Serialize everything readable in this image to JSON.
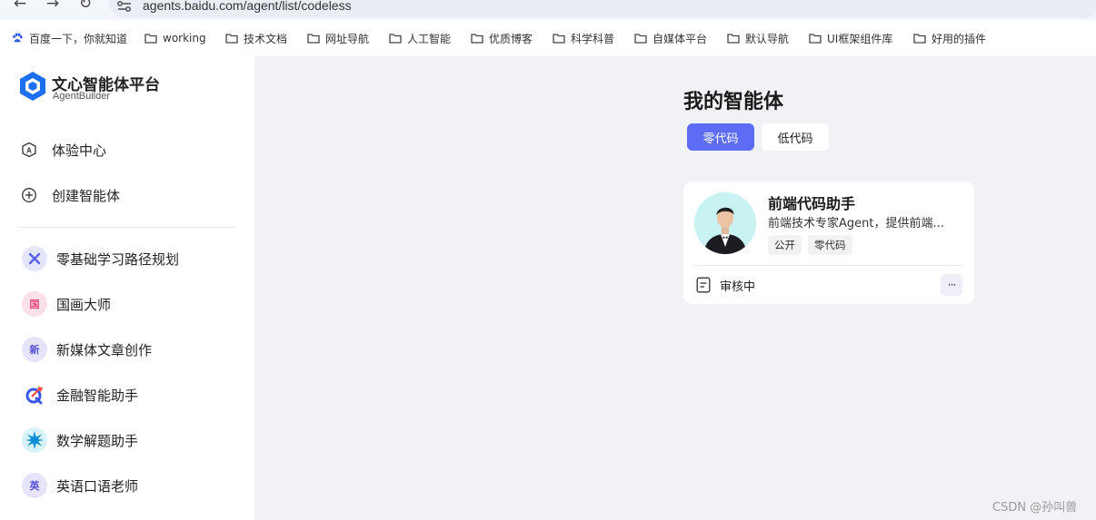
{
  "browser": {
    "url": "agents.baidu.com/agent/list/codeless",
    "bookmarks": [
      {
        "label": "百度一下，你就知道",
        "icon": "baidu-paw-icon"
      },
      {
        "label": "working",
        "icon": "folder-icon"
      },
      {
        "label": "技术文档",
        "icon": "folder-icon"
      },
      {
        "label": "网址导航",
        "icon": "folder-icon"
      },
      {
        "label": "人工智能",
        "icon": "folder-icon"
      },
      {
        "label": "优质博客",
        "icon": "folder-icon"
      },
      {
        "label": "科学科普",
        "icon": "folder-icon"
      },
      {
        "label": "自媒体平台",
        "icon": "folder-icon"
      },
      {
        "label": "默认导航",
        "icon": "folder-icon"
      },
      {
        "label": "UI框架组件库",
        "icon": "folder-icon"
      },
      {
        "label": "好用的插件",
        "icon": "folder-icon"
      }
    ]
  },
  "sidebar": {
    "logo": {
      "name": "文心智能体平台",
      "sub": "AgentBuilder"
    },
    "menu": [
      {
        "label": "体验中心",
        "icon": "experience-icon"
      },
      {
        "label": "创建智能体",
        "icon": "plus-circle-icon"
      }
    ],
    "agents": [
      {
        "label": "零基础学习路径规划",
        "avatar_text": "",
        "icon": "cross-icon"
      },
      {
        "label": "国画大师",
        "avatar_text": "国"
      },
      {
        "label": "新媒体文章创作",
        "avatar_text": "新"
      },
      {
        "label": "金融智能助手",
        "avatar_text": "",
        "icon": "finance-icon"
      },
      {
        "label": "数学解题助手",
        "avatar_text": "",
        "icon": "starburst-icon"
      },
      {
        "label": "英语口语老师",
        "avatar_text": "英"
      }
    ]
  },
  "main": {
    "title": "我的智能体",
    "tabs": [
      {
        "label": "零代码",
        "active": true
      },
      {
        "label": "低代码",
        "active": false
      }
    ],
    "card": {
      "name": "前端代码助手",
      "description": "前端技术专家Agent，提供前端...",
      "tags": [
        "公开",
        "零代码"
      ],
      "status": "审核中",
      "more": "···"
    }
  },
  "watermark": "CSDN @孙叫兽",
  "colors": {
    "accent": "#5c6cf5",
    "page_bg": "#f1f2f6"
  }
}
